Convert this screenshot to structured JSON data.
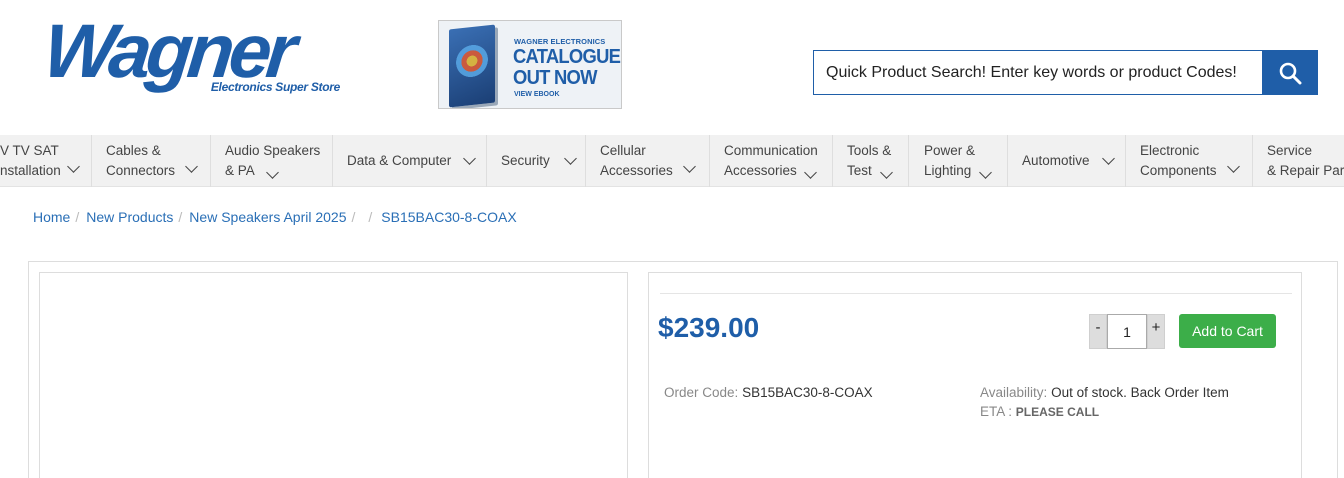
{
  "brand": {
    "logo_text": "Wagner",
    "logo_tagline": "Electronics Super Store"
  },
  "catalogue_banner": {
    "small_text": "WAGNER ELECTRONICS",
    "headline_line1": "CATALOGUE",
    "headline_line2": "OUT NOW",
    "link_text": "VIEW EBOOK"
  },
  "search": {
    "placeholder": "Quick Product Search! Enter key words or product Codes!",
    "button_icon": "search-icon"
  },
  "nav": {
    "items": [
      {
        "label": "V TV SAT\nnstallation"
      },
      {
        "label": "Cables &\nConnectors"
      },
      {
        "label": "Audio Speakers\n& PA"
      },
      {
        "label": "Data & Computer"
      },
      {
        "label": "Security"
      },
      {
        "label": "Cellular\nAccessories"
      },
      {
        "label": "Communication\nAccessories"
      },
      {
        "label": "Tools &\nTest"
      },
      {
        "label": "Power &\nLighting"
      },
      {
        "label": "Automotive"
      },
      {
        "label": "Electronic\nComponents"
      },
      {
        "label": "Service\n& Repair Part"
      }
    ]
  },
  "breadcrumb": {
    "items": [
      "Home",
      "New Products",
      "New Speakers April 2025",
      "",
      "SB15BAC30-8-COAX"
    ],
    "separator": "/"
  },
  "product": {
    "price": "$239.00",
    "quantity": "1",
    "qty_minus_label": "-",
    "qty_plus_label": "+",
    "add_to_cart_label": "Add to Cart",
    "order_code_label": "Order Code:",
    "order_code": "SB15BAC30-8-COAX",
    "availability_label": "Availability:",
    "availability": "Out of stock. Back Order Item",
    "eta_label": "ETA :",
    "eta_value": "PLEASE CALL"
  },
  "colors": {
    "brand_blue": "#1f5ea8",
    "link_blue": "#2a6fb6",
    "cart_green": "#3cae49"
  }
}
